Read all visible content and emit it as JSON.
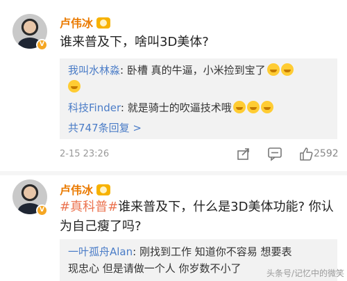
{
  "comments": [
    {
      "user": "卢伟冰",
      "text": "谁来普及下，啥叫3D美体?",
      "replies": [
        {
          "name": "我叫水林淼",
          "text": ": 卧槽  真的牛逼，小米捡到宝了"
        },
        {
          "name": "科技Finder",
          "text": ": 就是骑士的吹逼技术哦"
        }
      ],
      "more_replies": "共747条回复 >",
      "date": "2-15 23:26",
      "likes": "2592"
    },
    {
      "user": "卢伟冰",
      "tag": "#真科普#",
      "text_line1": "谁来普及下，什么是3D美体功能? 你认",
      "text_line2": "为自己瘦了吗?",
      "reply": {
        "name": "一叶孤舟Alan",
        "line1": ": 刚找到工作  知道你不容易  想要表",
        "line2": "现忠心  但是请做一个人  你岁数不小了"
      }
    }
  ],
  "watermark": "头条号/记忆中的微笑",
  "icons": [
    "share-icon",
    "comment-icon",
    "like-icon",
    "verified-badge-icon",
    "rank-badge-icon",
    "laugh-emoji-icon"
  ],
  "colors": {
    "name": "#ea7a00",
    "link": "#4a7cc7",
    "tag": "#eb7350",
    "reply_bg": "#f2f2f2"
  }
}
